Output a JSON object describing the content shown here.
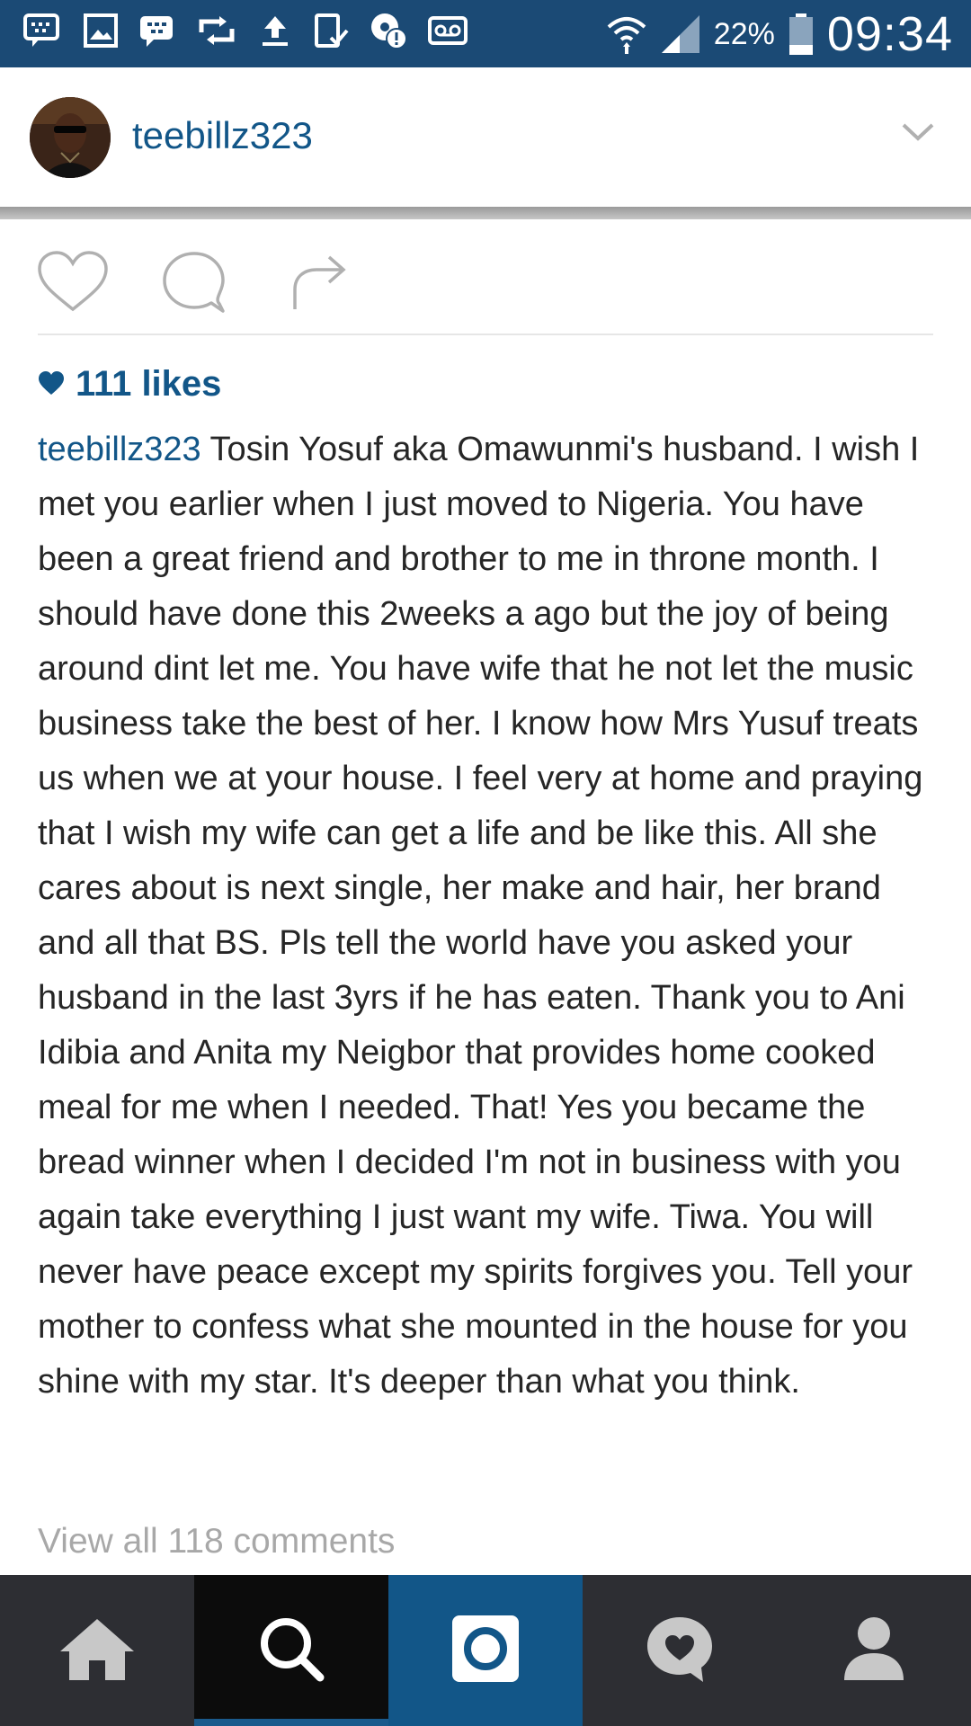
{
  "status_bar": {
    "battery": "22%",
    "time": "09:34",
    "icons": [
      "chat-icon",
      "image-icon",
      "blackberry-icon",
      "retweet-icon",
      "upload-icon",
      "tablet-check-icon",
      "settings-alert-icon",
      "voicemail-icon",
      "wifi-icon",
      "signal-icon",
      "battery-icon"
    ]
  },
  "post": {
    "username": "teebillz323",
    "likes": "111 likes",
    "caption_user": "teebillz323",
    "caption_text": " Tosin Yosuf aka Omawunmi's husband. I wish I met you earlier when I just moved to Nigeria. You have been a great friend and brother to me in throne month. I should have done this 2weeks a ago but the joy of being around dint let me. You have wife that he not let the music business take the best of her. I know how Mrs Yusuf treats us when we at your house. I feel very at home and praying that I wish my wife can get a life and be like this. All she cares about is next single, her make and hair, her brand and all that BS. Pls tell the world have you asked your husband in the last 3yrs if he has eaten. Thank you to Ani Idibia and Anita my Neigbor that provides home cooked meal for me when I needed. That! Yes you became the bread winner when I decided I'm not in business with you again take everything I just want my wife. Tiwa. You will never have peace except my spirits forgives you. Tell your mother to confess what she mounted in the house for you shine with my star. It's deeper than what you think.",
    "view_comments": "View all 118 comments"
  },
  "actions": [
    "heart-icon",
    "comment-icon",
    "share-icon"
  ],
  "nav": {
    "items": [
      "home-icon",
      "search-icon",
      "camera-icon",
      "activity-icon",
      "profile-icon"
    ],
    "active": "search-icon"
  },
  "colors": {
    "status_bar": "#1b4a75",
    "brand_blue": "#125688",
    "nav_bg": "#2d2e33",
    "text": "#262626",
    "muted": "#a8a8a8"
  }
}
